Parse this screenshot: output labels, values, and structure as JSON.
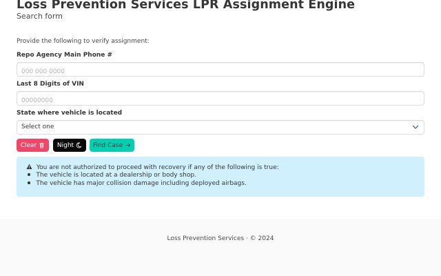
{
  "header": {
    "title": "Loss Prevention Services LPR Assignment Engine",
    "subtitle": "Search form"
  },
  "form": {
    "intro": "Provide the following to verify assignment:",
    "phone_label": "Repo Agency Main Phone #",
    "phone_placeholder": "000 000 0000",
    "vin_label": "Last 8 Digits of VIN",
    "vin_placeholder": "00000000",
    "state_label": "State where vehicle is located",
    "state_selected": "Select one"
  },
  "buttons": {
    "clear_label": "Clear",
    "night_label": "Night",
    "find_label": "Find Case"
  },
  "notice": {
    "heading": "You are not authorized to proceed with recovery if any of the following is true:",
    "items": [
      "The vehicle is located at a dealership or body shop.",
      "The vehicle has major collision damage including deployed airbags."
    ]
  },
  "footer": {
    "text": "Loss Prevention Services · © 2024"
  },
  "colors": {
    "clear_button": "#f14668",
    "night_button": "#0a0a0a",
    "find_button": "#00d1b2",
    "notice_background": "#cff0fc",
    "footer_background": "#fafafa"
  },
  "icons": {
    "clear": "trash-icon",
    "night": "moon-icon",
    "find": "arrow-right-icon",
    "notice": "warning-triangle-icon",
    "select": "chevron-down-icon"
  }
}
